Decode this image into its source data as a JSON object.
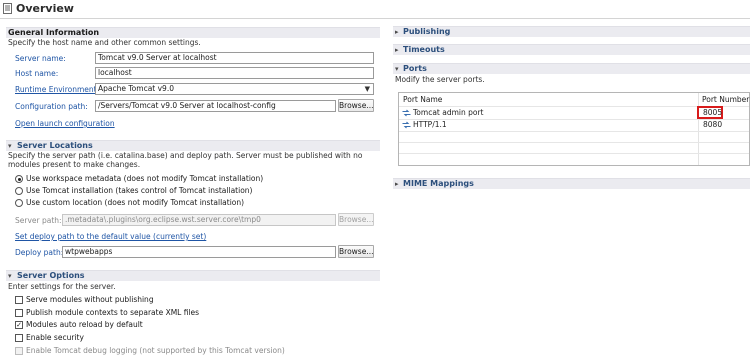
{
  "title": "Overview",
  "general": {
    "header": "General Information",
    "description": "Specify the host name and other common settings.",
    "server_name_label": "Server name:",
    "server_name_value": "Tomcat v9.0 Server at localhost",
    "host_name_label": "Host name:",
    "host_name_value": "localhost",
    "runtime_label": "Runtime Environment:",
    "runtime_value": "Apache Tomcat v9.0",
    "config_label": "Configuration path:",
    "config_value": "/Servers/Tomcat v9.0 Server at localhost-config",
    "browse": "Browse...",
    "open_launch": "Open launch configuration"
  },
  "locations": {
    "header": "Server Locations",
    "description": "Specify the server path (i.e. catalina.base) and deploy path. Server must be published with no modules present to make changes.",
    "options": [
      "Use workspace metadata (does not modify Tomcat installation)",
      "Use Tomcat installation (takes control of Tomcat installation)",
      "Use custom location (does not modify Tomcat installation)"
    ],
    "selected_index": 0,
    "server_path_label": "Server path:",
    "server_path_value": ".metadata\\.plugins\\org.eclipse.wst.server.core\\tmp0",
    "browse": "Browse...",
    "set_default": "Set deploy path to the default value (currently set)",
    "deploy_path_label": "Deploy path:",
    "deploy_path_value": "wtpwebapps",
    "browse2": "Browse..."
  },
  "options": {
    "header": "Server Options",
    "description": "Enter settings for the server.",
    "items": [
      {
        "label": "Serve modules without publishing",
        "checked": false,
        "enabled": true
      },
      {
        "label": "Publish module contexts to separate XML files",
        "checked": false,
        "enabled": true
      },
      {
        "label": "Modules auto reload by default",
        "checked": true,
        "enabled": true
      },
      {
        "label": "Enable security",
        "checked": false,
        "enabled": true
      },
      {
        "label": "Enable Tomcat debug logging (not supported by this Tomcat version)",
        "checked": false,
        "enabled": false
      }
    ]
  },
  "right": {
    "publishing": "Publishing",
    "timeouts": "Timeouts",
    "ports_header": "Ports",
    "ports_description": "Modify the server ports.",
    "col_name": "Port Name",
    "col_number": "Port Number",
    "ports": [
      {
        "name": "Tomcat admin port",
        "number": "8005"
      },
      {
        "name": "HTTP/1.1",
        "number": "8080"
      }
    ],
    "mime": "MIME Mappings"
  },
  "colors": {
    "section_header_bg": "#ebebf0",
    "link_blue": "#1f55a5",
    "highlight_red": "#d81b1b"
  }
}
